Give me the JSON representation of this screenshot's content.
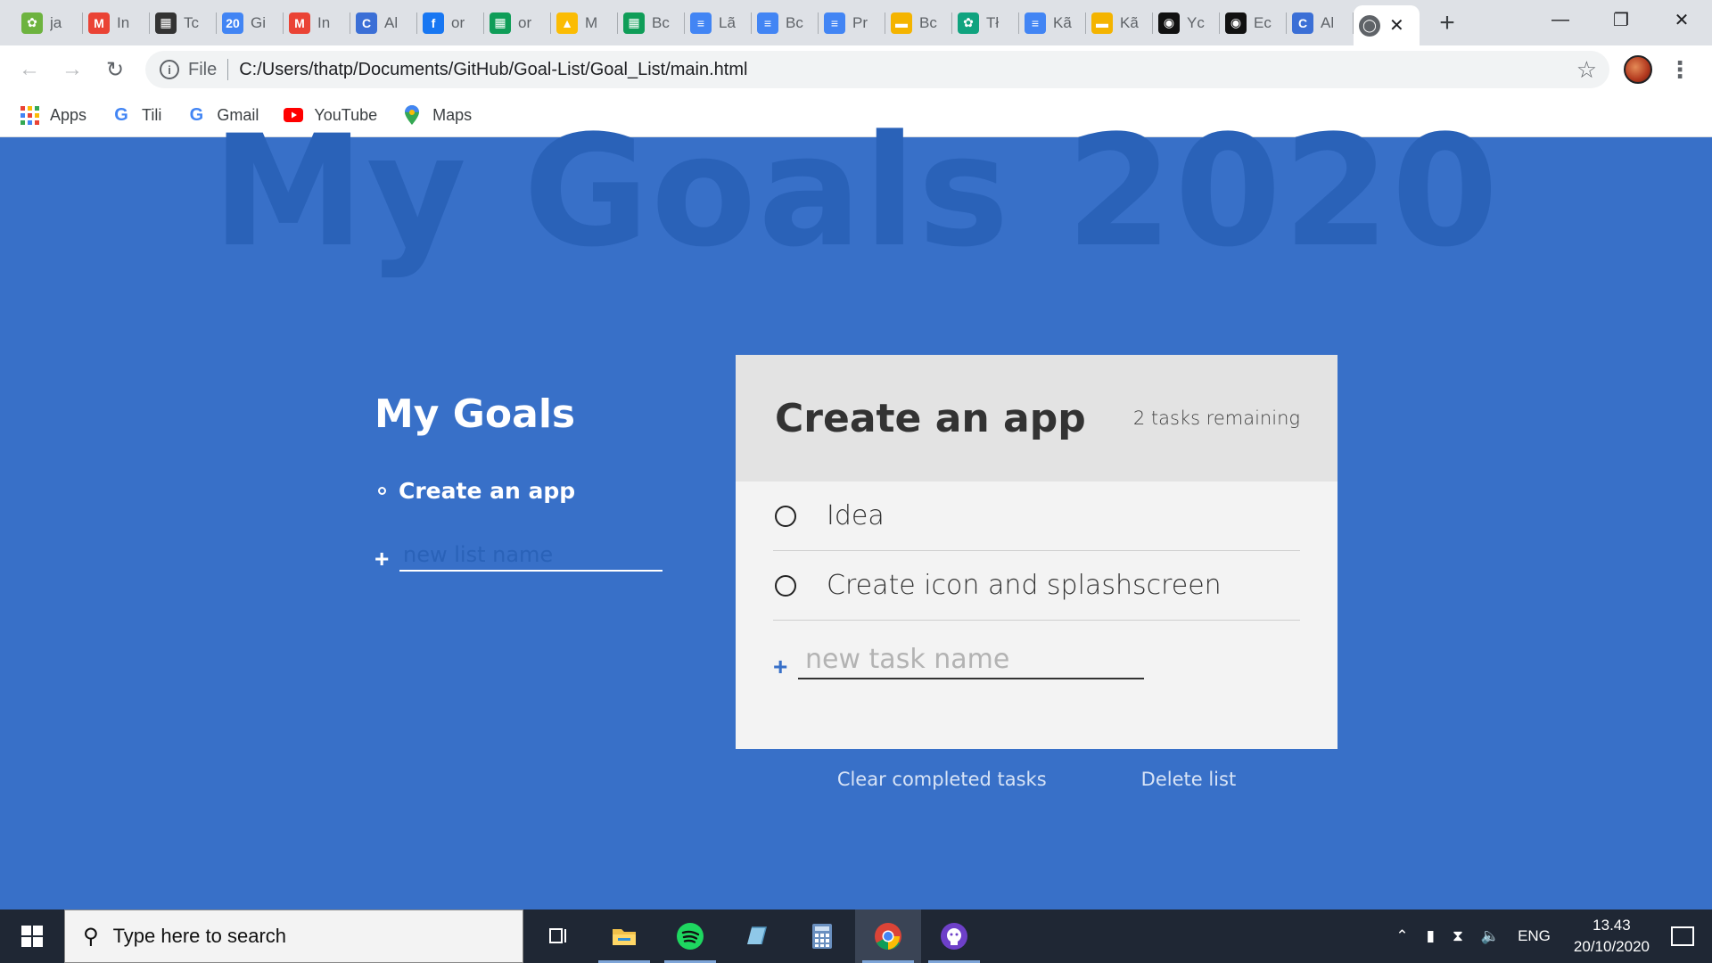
{
  "browser": {
    "tabs": [
      {
        "title": "ja",
        "icon": "leaf-icon",
        "color": "#6db33f"
      },
      {
        "title": "In",
        "icon": "gmail-icon",
        "color": "#ea4335"
      },
      {
        "title": "Tc",
        "icon": "notebook-icon",
        "color": "#333333"
      },
      {
        "title": "Gi",
        "icon": "calendar-icon",
        "color": "#4285f4"
      },
      {
        "title": "In",
        "icon": "gmail-icon",
        "color": "#ea4335"
      },
      {
        "title": "Al",
        "icon": "c-icon",
        "color": "#3b6fd6"
      },
      {
        "title": "or",
        "icon": "facebook-icon",
        "color": "#1877f2"
      },
      {
        "title": "or",
        "icon": "sheets-icon",
        "color": "#0f9d58"
      },
      {
        "title": "M",
        "icon": "drive-icon",
        "color": "#fbbc04"
      },
      {
        "title": "Bc",
        "icon": "sheets-icon",
        "color": "#0f9d58"
      },
      {
        "title": "Lã",
        "icon": "docs-icon",
        "color": "#4285f4"
      },
      {
        "title": "Bc",
        "icon": "docs-icon",
        "color": "#4285f4"
      },
      {
        "title": "Pr",
        "icon": "docs-icon",
        "color": "#4285f4"
      },
      {
        "title": "Bc",
        "icon": "slides-icon",
        "color": "#f4b400"
      },
      {
        "title": "Tł",
        "icon": "chatgpt-icon",
        "color": "#10a37f"
      },
      {
        "title": "Kã",
        "icon": "docs-icon",
        "color": "#4285f4"
      },
      {
        "title": "Kã",
        "icon": "slides-icon",
        "color": "#f4b400"
      },
      {
        "title": "Yc",
        "icon": "github-icon",
        "color": "#111111"
      },
      {
        "title": "Ec",
        "icon": "github-icon",
        "color": "#111111"
      },
      {
        "title": "Al",
        "icon": "c-icon",
        "color": "#3b6fd6"
      }
    ],
    "active_tab_close": "✕",
    "new_tab": "+",
    "address": {
      "scheme": "File",
      "url": "C:/Users/thatp/Documents/GitHub/Goal-List/Goal_List/main.html"
    },
    "bookmarks": [
      {
        "label": "Apps",
        "icon": "apps-grid-icon"
      },
      {
        "label": "Tili",
        "icon": "google-icon"
      },
      {
        "label": "Gmail",
        "icon": "google-icon"
      },
      {
        "label": "YouTube",
        "icon": "youtube-icon"
      },
      {
        "label": "Maps",
        "icon": "maps-pin-icon"
      }
    ]
  },
  "page": {
    "background_title": "My Goals 2020",
    "goals_heading": "My Goals",
    "lists": [
      {
        "name": "Create an app"
      }
    ],
    "new_list_placeholder": "new list name",
    "active_list": {
      "title": "Create an app",
      "remaining": "2 tasks remaining",
      "tasks": [
        {
          "label": "Idea"
        },
        {
          "label": "Create icon and splashscreen"
        }
      ],
      "new_task_placeholder": "new task name"
    },
    "clear_completed": "Clear completed tasks",
    "delete_list": "Delete list",
    "colors": {
      "background": "#3870c8",
      "card": "#f3f3f3",
      "card_header": "#e3e3e3"
    }
  },
  "taskbar": {
    "search_placeholder": "Type here to search",
    "language": "ENG",
    "time": "13.43",
    "date": "20/10/2020"
  }
}
